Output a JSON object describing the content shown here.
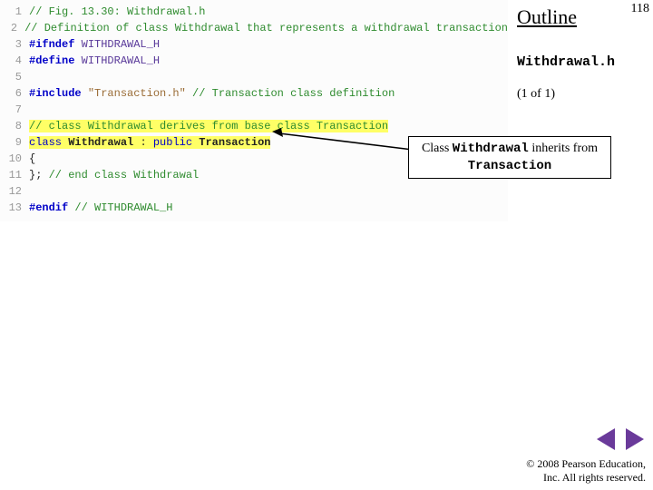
{
  "header": {
    "outline": "Outline",
    "page_number": "118",
    "filename": "Withdrawal.h",
    "page_of": "(1 of 1)"
  },
  "callout": {
    "prefix": "Class ",
    "classname": "Withdrawal",
    "mid": " inherits from ",
    "basename": "Transaction"
  },
  "code": {
    "lines": [
      {
        "n": "1",
        "t": [
          {
            "c": "tok-comment",
            "s": "// Fig. 13.30: Withdrawal.h"
          }
        ]
      },
      {
        "n": "2",
        "t": [
          {
            "c": "tok-comment",
            "s": "// Definition of class Withdrawal that represents a withdrawal transaction"
          }
        ]
      },
      {
        "n": "3",
        "t": [
          {
            "c": "tok-keyword-b",
            "s": "#ifndef"
          },
          {
            "c": "tok-plain",
            "s": " "
          },
          {
            "c": "tok-macroid",
            "s": "WITHDRAWAL_H"
          }
        ]
      },
      {
        "n": "4",
        "t": [
          {
            "c": "tok-keyword-b",
            "s": "#define"
          },
          {
            "c": "tok-plain",
            "s": " "
          },
          {
            "c": "tok-macroid",
            "s": "WITHDRAWAL_H"
          }
        ]
      },
      {
        "n": "5",
        "t": []
      },
      {
        "n": "6",
        "t": [
          {
            "c": "tok-keyword-b",
            "s": "#include"
          },
          {
            "c": "tok-plain",
            "s": " "
          },
          {
            "c": "tok-string",
            "s": "\"Transaction.h\""
          },
          {
            "c": "tok-plain",
            "s": " "
          },
          {
            "c": "tok-comment",
            "s": "// Transaction class definition"
          }
        ]
      },
      {
        "n": "7",
        "t": []
      },
      {
        "n": "8",
        "t": [
          {
            "c": "tok-comment hl-yellow",
            "s": "// class Withdrawal derives from base class Transaction"
          }
        ]
      },
      {
        "n": "9",
        "t": [
          {
            "c": "tok-keyword hl-yellow",
            "s": "class"
          },
          {
            "c": "hl-yellow",
            "s": " "
          },
          {
            "c": "tok-ident hl-yellow",
            "s": "Withdrawal"
          },
          {
            "c": "hl-yellow",
            "s": " "
          },
          {
            "c": "tok-plain hl-yellow",
            "s": ":"
          },
          {
            "c": "hl-yellow",
            "s": " "
          },
          {
            "c": "tok-keyword hl-yellow",
            "s": "public"
          },
          {
            "c": "hl-yellow",
            "s": " "
          },
          {
            "c": "tok-ident hl-yellow",
            "s": "Transaction"
          }
        ]
      },
      {
        "n": "10",
        "t": [
          {
            "c": "tok-plain",
            "s": "{"
          }
        ]
      },
      {
        "n": "11",
        "t": [
          {
            "c": "tok-plain",
            "s": "};"
          },
          {
            "c": "tok-plain",
            "s": " "
          },
          {
            "c": "tok-comment",
            "s": "// end class Withdrawal"
          }
        ]
      },
      {
        "n": "12",
        "t": []
      },
      {
        "n": "13",
        "t": [
          {
            "c": "tok-keyword-b",
            "s": "#endif"
          },
          {
            "c": "tok-plain",
            "s": " "
          },
          {
            "c": "tok-comment",
            "s": "// WITHDRAWAL_H"
          }
        ]
      }
    ]
  },
  "footer": {
    "copyright_l1": "© 2008 Pearson Education,",
    "copyright_l2": "Inc.  All rights reserved."
  },
  "icons": {
    "prev": "nav-prev-icon",
    "next": "nav-next-icon"
  }
}
